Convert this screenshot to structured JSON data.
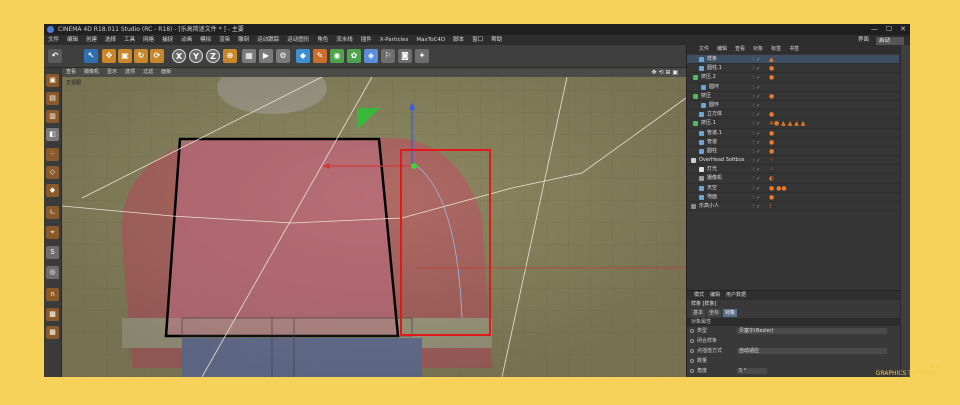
{
  "window": {
    "title": "CINEMA 4D R18.011 Studio (RC - R18) - [乐高简迷文件 * ] - 主要",
    "buttons": [
      "—",
      "☐",
      "✕"
    ]
  },
  "menubar": {
    "items": [
      "文件",
      "编辑",
      "创建",
      "选择",
      "工具",
      "网格",
      "捕捉",
      "动画",
      "模拟",
      "渲染",
      "雕刻",
      "运动跟踪",
      "运动图形",
      "角色",
      "流水线",
      "插件",
      "X-Particles",
      "MaxToC4D",
      "脚本",
      "窗口",
      "帮助"
    ],
    "layout_label": "界面",
    "layout_value": "启动"
  },
  "toolbar": {
    "icons": [
      "undo-icon",
      "pointer-icon",
      "move-icon",
      "scale-icon",
      "rotate-icon",
      "refresh-icon",
      "x-axis-icon",
      "y-axis-icon",
      "z-axis-icon",
      "world-icon",
      "render-region-icon",
      "render-view-icon",
      "render-settings-icon",
      "cube-icon",
      "pen-icon",
      "subdivision-icon",
      "array-icon",
      "deformer-icon",
      "scene-icon",
      "camera-icon",
      "light-icon"
    ],
    "labels": [
      "X",
      "Y",
      "Z"
    ]
  },
  "viewport": {
    "menu": [
      "查看",
      "摄像机",
      "显示",
      "选项",
      "过滤",
      "面板"
    ],
    "label": "正视图"
  },
  "object_manager": {
    "menu": [
      "文件",
      "编辑",
      "查看",
      "对象",
      "标签",
      "书签"
    ],
    "rows": [
      {
        "name": "样条",
        "indent": 12,
        "icon": "#6fa3d8",
        "sel": true,
        "tags": "▲"
      },
      {
        "name": "圆柱.1",
        "indent": 12,
        "icon": "#6fa3d8",
        "sel": false,
        "tags": "●"
      },
      {
        "name": "挤压.2",
        "indent": 6,
        "icon": "#56b85c",
        "sel": false,
        "tags": "●"
      },
      {
        "name": "圆环",
        "indent": 14,
        "icon": "#6fa3d8",
        "sel": false,
        "tags": ""
      },
      {
        "name": "挤压",
        "indent": 6,
        "icon": "#56b85c",
        "sel": false,
        "tags": "●"
      },
      {
        "name": "圆环",
        "indent": 14,
        "icon": "#6fa3d8",
        "sel": false,
        "tags": ""
      },
      {
        "name": "立方体",
        "indent": 12,
        "icon": "#6fa3d8",
        "sel": false,
        "tags": "●"
      },
      {
        "name": "挤压.1",
        "indent": 6,
        "icon": "#56b85c",
        "sel": false,
        "tags": "✕● ▲ ▲ ▲ ▲"
      },
      {
        "name": "管道.1",
        "indent": 12,
        "icon": "#6fa3d8",
        "sel": false,
        "tags": "●"
      },
      {
        "name": "管道",
        "indent": 12,
        "icon": "#6fa3d8",
        "sel": false,
        "tags": "●"
      },
      {
        "name": "圆柱",
        "indent": 12,
        "icon": "#6fa3d8",
        "sel": false,
        "tags": "●"
      },
      {
        "name": "OverHead Softbox",
        "indent": 4,
        "icon": "#cfcfcf",
        "sel": false,
        "tags": "⁘"
      },
      {
        "name": "灯光",
        "indent": 12,
        "icon": "#e0e0e0",
        "sel": false,
        "tags": "⁘"
      },
      {
        "name": "摄像机",
        "indent": 12,
        "icon": "#9c9c9c",
        "sel": false,
        "tags": "◐"
      },
      {
        "name": "天空",
        "indent": 12,
        "icon": "#6fa3d8",
        "sel": false,
        "tags": "● ●●"
      },
      {
        "name": "地面",
        "indent": 12,
        "icon": "#6fa3d8",
        "sel": false,
        "tags": "●"
      },
      {
        "name": "乐高小人",
        "indent": 4,
        "icon": "#8a8a8a",
        "sel": false,
        "tags": "!"
      }
    ]
  },
  "attributes": {
    "menu": [
      "模式",
      "编辑",
      "用户数据"
    ],
    "title": "样条 [样条]",
    "tabs": [
      {
        "label": "基本",
        "on": false
      },
      {
        "label": "坐标",
        "on": false
      },
      {
        "label": "对象",
        "on": true
      }
    ],
    "section": "对象属性",
    "rows": [
      {
        "label": "类型",
        "value": "贝塞尔(Bezier)"
      },
      {
        "label": "闭合样条",
        "value": ""
      },
      {
        "label": "点插值方式",
        "value": "自动适应"
      },
      {
        "label": "数量",
        "value": ""
      },
      {
        "label": "角度",
        "value": "5 °"
      },
      {
        "label": "最大长度",
        "value": ""
      }
    ]
  },
  "watermark": {
    "line1": "4D",
    "line2": "GRAPHICS TUTORIAL"
  }
}
